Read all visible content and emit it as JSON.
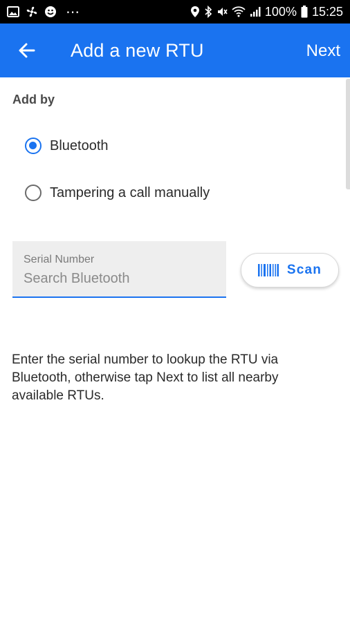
{
  "status_bar": {
    "battery": "100%",
    "time": "15:25",
    "more": "⋯",
    "icons_left": [
      "image-icon",
      "fan-icon",
      "emoji-icon"
    ],
    "icons_right": [
      "location-icon",
      "bluetooth-icon",
      "mute-icon",
      "wifi-icon",
      "signal-icon",
      "battery-icon"
    ]
  },
  "app_bar": {
    "title": "Add a new RTU",
    "next_label": "Next",
    "color": "#1a73f0"
  },
  "form": {
    "add_by_label": "Add by",
    "options": [
      {
        "label": "Bluetooth",
        "selected": true
      },
      {
        "label": "Tampering a call manually",
        "selected": false
      }
    ],
    "serial": {
      "label": "Serial Number",
      "placeholder": "Search Bluetooth"
    },
    "scan_label": "Scan",
    "help_text": "Enter the serial number to lookup the RTU via Bluetooth, otherwise tap Next to list all nearby available RTUs."
  }
}
